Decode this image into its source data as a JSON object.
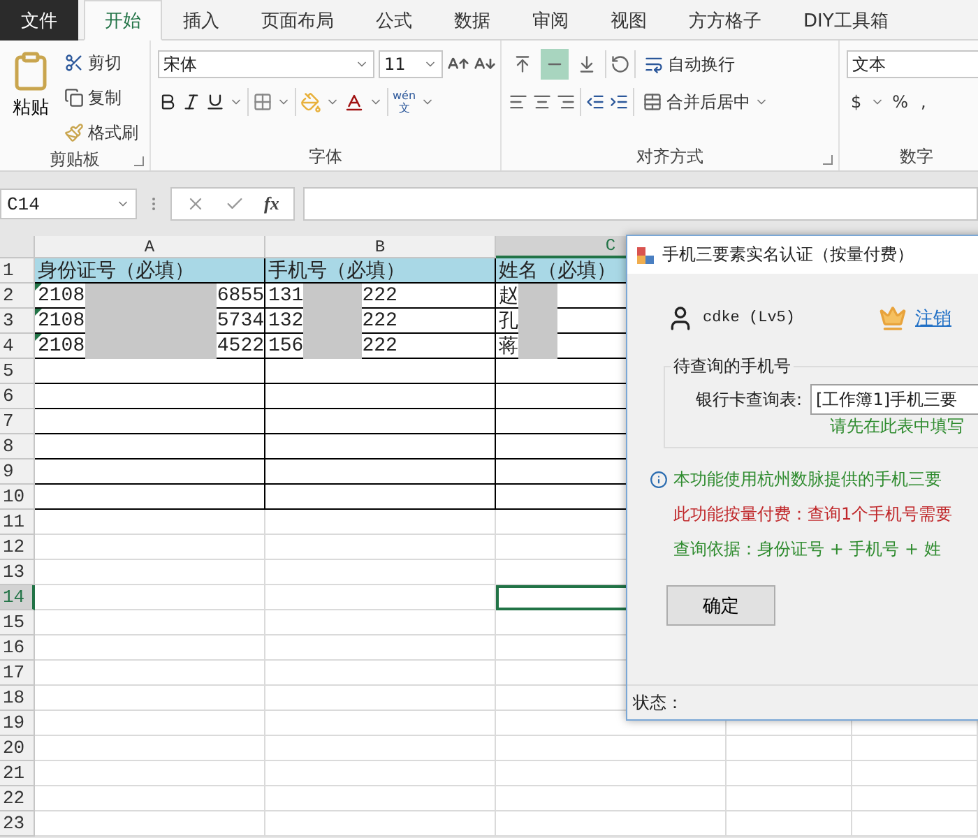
{
  "tabs": [
    {
      "label": "文件",
      "kind": "file",
      "selected": false
    },
    {
      "label": "开始",
      "kind": "tab",
      "selected": true
    },
    {
      "label": "插入",
      "kind": "tab",
      "selected": false
    },
    {
      "label": "页面布局",
      "kind": "tab",
      "selected": false
    },
    {
      "label": "公式",
      "kind": "tab",
      "selected": false
    },
    {
      "label": "数据",
      "kind": "tab",
      "selected": false
    },
    {
      "label": "审阅",
      "kind": "tab",
      "selected": false
    },
    {
      "label": "视图",
      "kind": "tab",
      "selected": false
    },
    {
      "label": "方方格子",
      "kind": "tab",
      "selected": false
    },
    {
      "label": "DIY工具箱",
      "kind": "tab",
      "selected": false
    }
  ],
  "ribbon": {
    "clipboard": {
      "paste": "粘贴",
      "cut": "剪切",
      "copy": "复制",
      "format_painter": "格式刷",
      "group": "剪贴板"
    },
    "font": {
      "name": "宋体",
      "size": "11",
      "phonetic_top": "wén",
      "phonetic_bottom": "文",
      "group": "字体"
    },
    "alignment": {
      "vertical_buttons": [
        {
          "selected": false
        },
        {
          "selected": true
        },
        {
          "selected": false
        }
      ],
      "wrap": "自动换行",
      "merge": "合并后居中",
      "group": "对齐方式"
    },
    "number": {
      "format": "文本",
      "currency": "$",
      "percent": "%",
      "comma": ",",
      "group": "数字"
    }
  },
  "formula_bar": {
    "name_box": "C14",
    "fx": "fx"
  },
  "sheet": {
    "columns": [
      {
        "label": "A",
        "selected": false
      },
      {
        "label": "B",
        "selected": false
      },
      {
        "label": "C",
        "selected": true
      }
    ],
    "rows": [
      {
        "number": "1",
        "bordered": true,
        "selected": false,
        "kind": "header",
        "cells": [
          {
            "parts": [
              "身份证号（必填）"
            ]
          },
          {
            "parts": [
              "手机号（必填）"
            ]
          },
          {
            "parts": [
              "姓名（必填）"
            ]
          }
        ]
      },
      {
        "number": "2",
        "bordered": true,
        "selected": false,
        "kind": "data",
        "cells": [
          {
            "parts": [
              "2108",
              "6855"
            ],
            "warning": true
          },
          {
            "parts": [
              "131",
              "222"
            ]
          },
          {
            "parts": [
              "赵"
            ]
          }
        ]
      },
      {
        "number": "3",
        "bordered": true,
        "selected": false,
        "kind": "data",
        "cells": [
          {
            "parts": [
              "2108",
              "5734"
            ],
            "warning": true
          },
          {
            "parts": [
              "132",
              "222"
            ]
          },
          {
            "parts": [
              "孔"
            ]
          }
        ]
      },
      {
        "number": "4",
        "bordered": true,
        "selected": false,
        "kind": "data",
        "cells": [
          {
            "parts": [
              "2108",
              "4522"
            ],
            "warning": true
          },
          {
            "parts": [
              "156",
              "222"
            ]
          },
          {
            "parts": [
              "蒋"
            ]
          }
        ]
      },
      {
        "number": "5",
        "bordered": true,
        "selected": false
      },
      {
        "number": "6",
        "bordered": true,
        "selected": false
      },
      {
        "number": "7",
        "bordered": true,
        "selected": false
      },
      {
        "number": "8",
        "bordered": true,
        "selected": false
      },
      {
        "number": "9",
        "bordered": true,
        "selected": false
      },
      {
        "number": "10",
        "bordered": true,
        "selected": false
      },
      {
        "number": "11",
        "bordered": false,
        "selected": false
      },
      {
        "number": "12",
        "bordered": false,
        "selected": false
      },
      {
        "number": "13",
        "bordered": false,
        "selected": false
      },
      {
        "number": "14",
        "bordered": false,
        "selected": true
      },
      {
        "number": "15",
        "bordered": false,
        "selected": false
      },
      {
        "number": "16",
        "bordered": false,
        "selected": false
      },
      {
        "number": "17",
        "bordered": false,
        "selected": false
      },
      {
        "number": "18",
        "bordered": false,
        "selected": false
      },
      {
        "number": "19",
        "bordered": false,
        "selected": false
      },
      {
        "number": "20",
        "bordered": false,
        "selected": false
      },
      {
        "number": "21",
        "bordered": false,
        "selected": false
      },
      {
        "number": "22",
        "bordered": false,
        "selected": false
      },
      {
        "number": "23",
        "bordered": false,
        "selected": false
      }
    ]
  },
  "dialog": {
    "title": "手机三要素实名认证（按量付费）",
    "user": "cdke (Lv5)",
    "logout": "注销",
    "group": {
      "legend": "待查询的手机号",
      "label": "银行卡查询表:",
      "value": "[工作簿1]手机三要",
      "hint": "请先在此表中填写"
    },
    "notes": [
      {
        "kind": "info",
        "text": "本功能使用杭州数脉提供的手机三要"
      },
      {
        "kind": "warning",
        "text": "此功能按量付费：查询1个手机号需要"
      },
      {
        "kind": "basis",
        "text": "查询依据：身份证号 + 手机号 + 姓"
      }
    ],
    "ok": "确定",
    "status": "状态："
  }
}
